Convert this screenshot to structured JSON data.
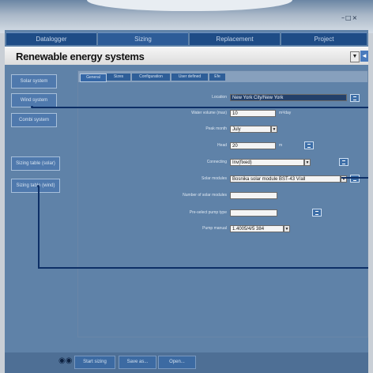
{
  "window": {
    "controls": "–□×"
  },
  "main_tabs": [
    "Datalogger",
    "Sizing",
    "Replacement",
    "Project"
  ],
  "project": {
    "title": "Renewable energy systems",
    "dropdown_icon": "chevron-down-icon",
    "button_icon": "arrow-icon"
  },
  "sidebar": {
    "items": [
      "Solar system",
      "Wind system",
      "Combi system",
      "Sizing table (solar)",
      "Sizing table (wind)"
    ]
  },
  "subtabs": [
    "General",
    "Sizes",
    "Configuration",
    "User defined",
    "Efe"
  ],
  "form": {
    "location_label": "Location",
    "location_value": "New York City/New York",
    "water_volume_label": "Water volume (max)",
    "water_volume_value": "10",
    "water_volume_unit": "m³/day",
    "peak_month_label": "Peak month",
    "peak_month_value": "July",
    "head_label": "Head",
    "head_value": "20",
    "head_unit": "m",
    "connecting_label": "Connecting",
    "connecting_value": "Inv(fixed)",
    "solar_modules_label": "Solar modules",
    "solar_modules_value": "Bosnika solar module BST-43 V/all",
    "num_modules_label": "Number of solar modules",
    "num_modules_value": "",
    "preselect_pump_label": "Pre-select pump type",
    "preselect_pump_value": "",
    "pump_manual_label": "Pump manual",
    "pump_manual_value": "1.4005/4/5 384"
  },
  "bottom_bar": {
    "binoculars_icon": "binoculars-icon",
    "buttons": [
      "Start sizing",
      "Save as...",
      "Open..."
    ]
  },
  "colors": {
    "panel": "#5f82a8",
    "tab": "#1e4c86",
    "accent": "#0d2f66"
  }
}
